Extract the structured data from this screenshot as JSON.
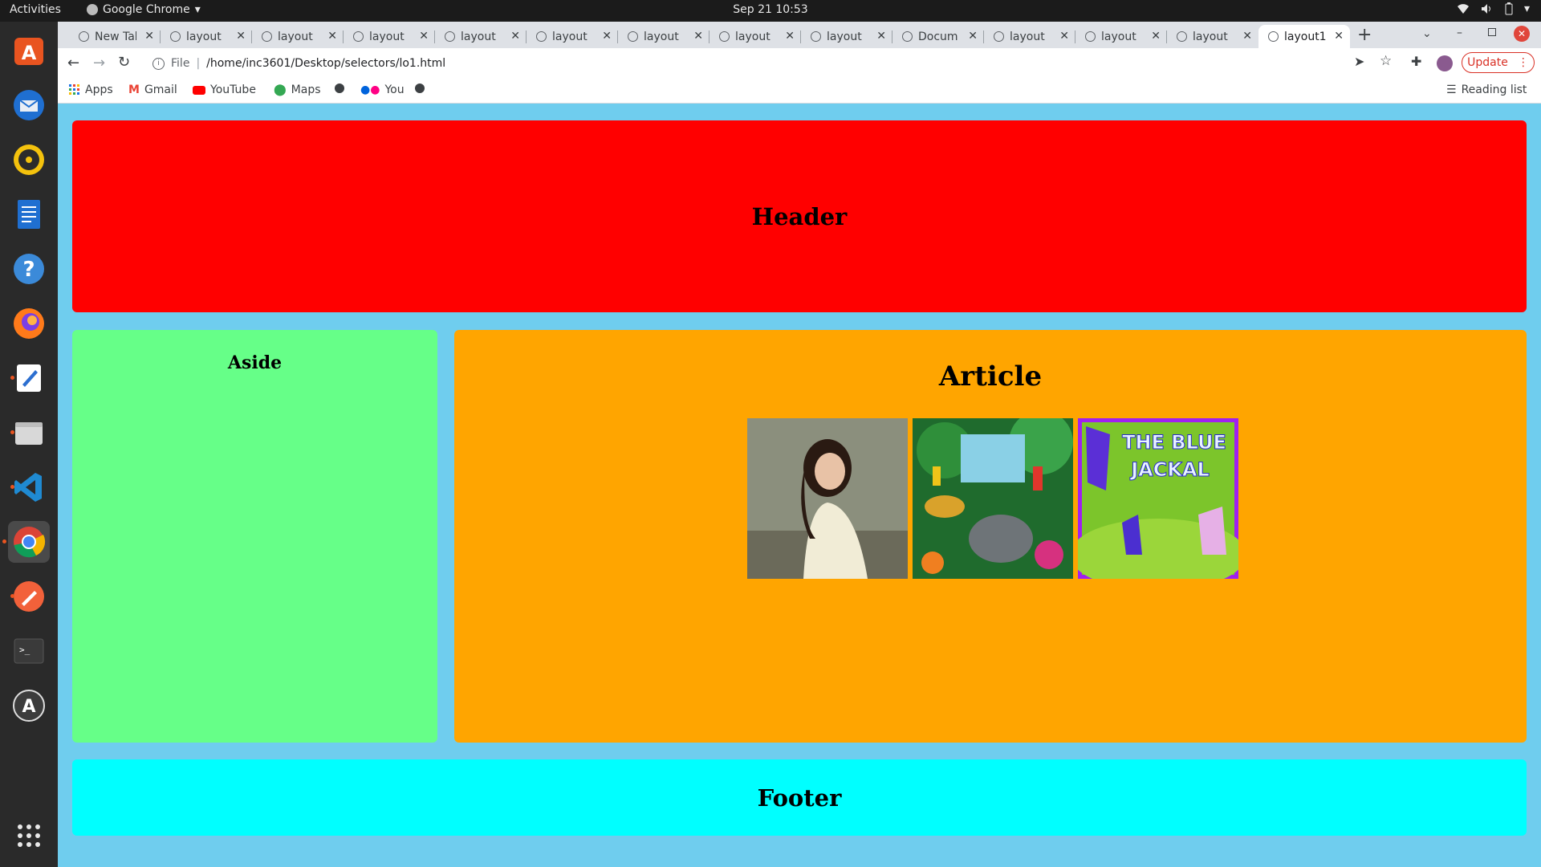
{
  "system": {
    "activities": "Activities",
    "app_name": "Google Chrome",
    "clock": "Sep 21  10:53"
  },
  "tabs": [
    {
      "title": "New Tab"
    },
    {
      "title": "layout"
    },
    {
      "title": "layout"
    },
    {
      "title": "layout"
    },
    {
      "title": "layout"
    },
    {
      "title": "layout"
    },
    {
      "title": "layout"
    },
    {
      "title": "layout"
    },
    {
      "title": "layout"
    },
    {
      "title": "Docum"
    },
    {
      "title": "layout"
    },
    {
      "title": "layout"
    },
    {
      "title": "layout"
    },
    {
      "title": "layout1",
      "active": true
    }
  ],
  "toolbar": {
    "scheme_label": "File",
    "url": "/home/inc3601/Desktop/selectors/lo1.html",
    "update_label": "Update"
  },
  "bookmarks": {
    "apps": "Apps",
    "gmail": "Gmail",
    "youtube": "YouTube",
    "maps": "Maps",
    "you": "You",
    "reading_list": "Reading list"
  },
  "page": {
    "header": "Header",
    "aside": "Aside",
    "article": "Article",
    "footer": "Footer"
  },
  "images": [
    {
      "name": "woman-photo"
    },
    {
      "name": "jungle-animals-painting"
    },
    {
      "name": "blue-jackal-cover",
      "caption": "THE BLUE JACKAL"
    }
  ],
  "colors": {
    "page_bg": "#6fcdee",
    "header": "#ff0000",
    "aside": "#66ff88",
    "article": "#ffa500",
    "footer": "#00ffff"
  }
}
